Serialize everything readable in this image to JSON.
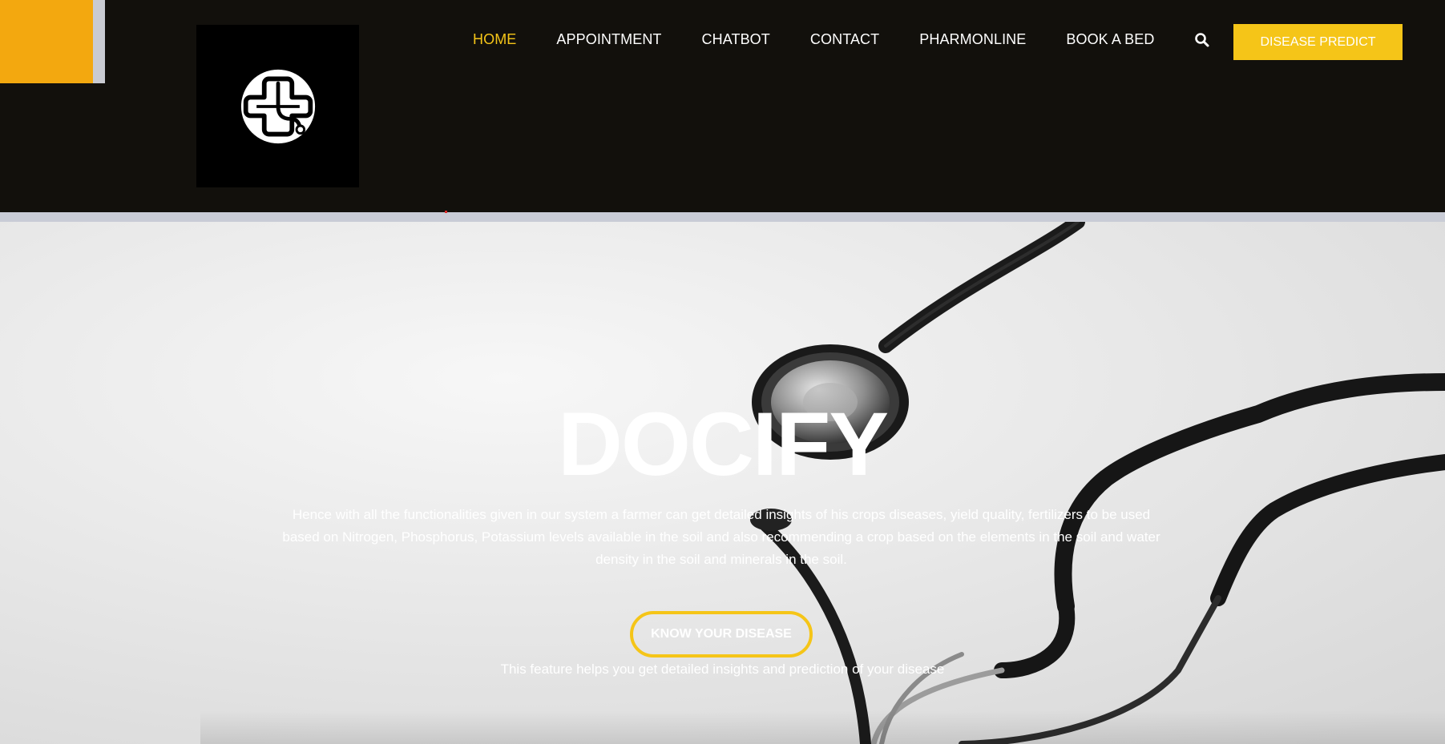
{
  "nav": {
    "items": [
      {
        "label": "HOME",
        "active": true
      },
      {
        "label": "APPOINTMENT",
        "active": false
      },
      {
        "label": "CHATBOT",
        "active": false
      },
      {
        "label": "CONTACT",
        "active": false
      },
      {
        "label": "PHARMONLINE",
        "active": false
      },
      {
        "label": "BOOK A BED",
        "active": false
      }
    ],
    "search_icon": "search-icon",
    "cta_label": "DISEASE PREDICT"
  },
  "logo": {
    "icon": "medical-cross-stethoscope-logo"
  },
  "hero": {
    "title": "DOCIFY",
    "description": "Hence with all the functionalities given in our system a farmer can get detailed insights of his crops diseases, yield quality, fertilizers to be used based on Nitrogen, Phosphorus, Potassium levels available in the soil and also recommending a crop based on the elements in the soil and water density in the soil and minerals in the soil.",
    "button_label": "KNOW YOUR DISEASE",
    "note": "This feature helps you get detailed insights and prediction of your disease",
    "background": "stethoscope-photo"
  },
  "colors": {
    "header_bg": "#12100c",
    "accent_yellow": "#f5c518",
    "corner_orange": "#f3a80f",
    "active_nav": "#f5c518"
  }
}
